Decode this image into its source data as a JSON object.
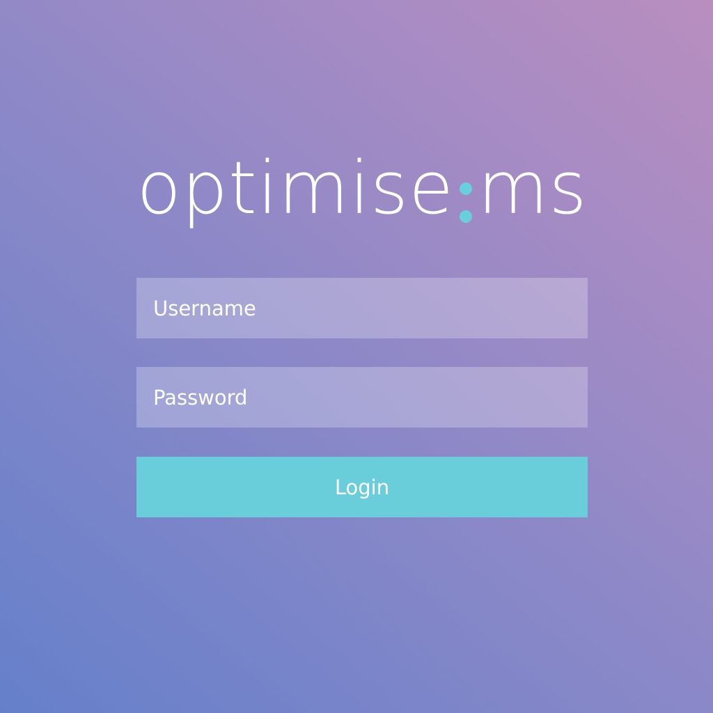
{
  "logo": {
    "left_word": "optimise",
    "right_word": "ms",
    "separator_color": "#6acfdc"
  },
  "form": {
    "username_placeholder": "Username",
    "password_placeholder": "Password",
    "login_label": "Login",
    "login_button_color": "#69ceda"
  }
}
